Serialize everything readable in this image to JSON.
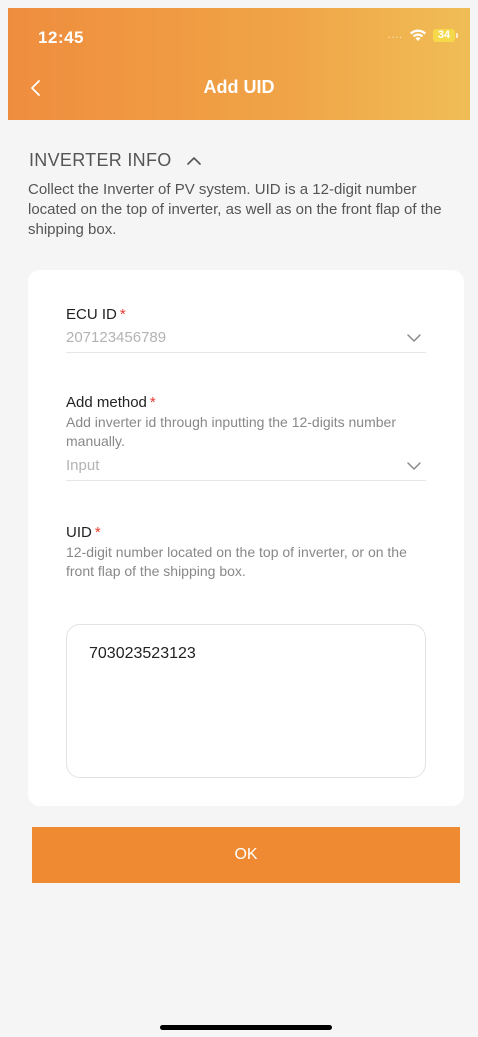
{
  "status_bar": {
    "time": "12:45",
    "signal": "....",
    "battery": "34"
  },
  "nav": {
    "title": "Add UID"
  },
  "section": {
    "title": "INVERTER INFO",
    "description": "Collect the Inverter of PV system. UID is a 12-digit number located on the top of inverter, as well as on the front flap of the shipping box."
  },
  "form": {
    "ecu": {
      "label": "ECU ID",
      "required": "*",
      "value": "207123456789"
    },
    "method": {
      "label": "Add method",
      "required": "*",
      "help": "Add inverter id through inputting the 12-digits number manually.",
      "value": "Input"
    },
    "uid": {
      "label": "UID",
      "required": "*",
      "help": "12-digit number located on the top of inverter, or on the front flap of the shipping box.",
      "value": "703023523123"
    }
  },
  "ok_label": "OK",
  "colors": {
    "accent": "#ef8a33",
    "required": "#e83a2f"
  }
}
